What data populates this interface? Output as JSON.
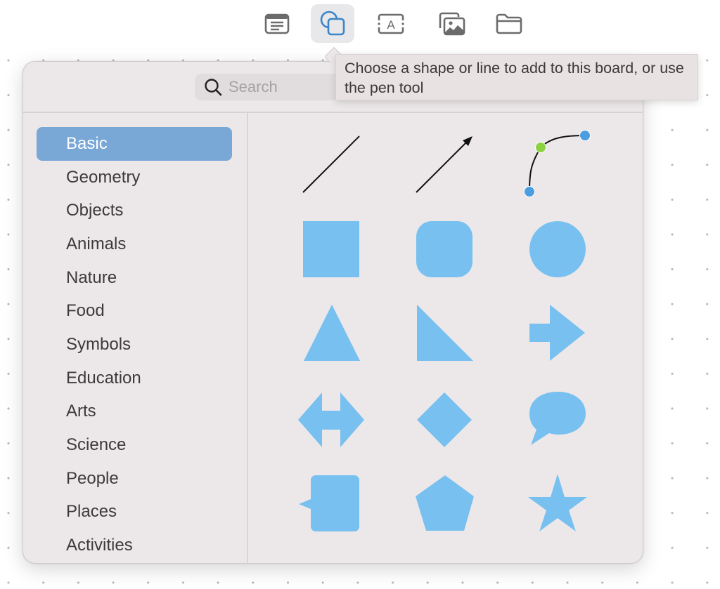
{
  "toolbar": {
    "buttons": [
      {
        "name": "text-box",
        "icon": "text-block-icon",
        "active": false
      },
      {
        "name": "shapes",
        "icon": "shapes-icon",
        "active": true
      },
      {
        "name": "text",
        "icon": "text-frame-icon",
        "active": false
      },
      {
        "name": "media",
        "icon": "photos-icon",
        "active": false
      },
      {
        "name": "files",
        "icon": "folder-icon",
        "active": false
      }
    ],
    "active_color": "#3a86c8",
    "icon_color": "#6b6b6b"
  },
  "tooltip": {
    "text": "Choose a shape or line to add to this board, or use the pen tool"
  },
  "shapes_popover": {
    "search": {
      "placeholder": "Search",
      "value": ""
    },
    "categories": [
      {
        "label": "Basic",
        "selected": true
      },
      {
        "label": "Geometry",
        "selected": false
      },
      {
        "label": "Objects",
        "selected": false
      },
      {
        "label": "Animals",
        "selected": false
      },
      {
        "label": "Nature",
        "selected": false
      },
      {
        "label": "Food",
        "selected": false
      },
      {
        "label": "Symbols",
        "selected": false
      },
      {
        "label": "Education",
        "selected": false
      },
      {
        "label": "Arts",
        "selected": false
      },
      {
        "label": "Science",
        "selected": false
      },
      {
        "label": "People",
        "selected": false
      },
      {
        "label": "Places",
        "selected": false
      },
      {
        "label": "Activities",
        "selected": false
      }
    ],
    "shapes": [
      "line",
      "arrow-line",
      "curve-pen",
      "square",
      "rounded-square",
      "circle",
      "triangle",
      "right-triangle",
      "arrow-right",
      "double-arrow",
      "diamond",
      "speech-bubble",
      "callout-square",
      "pentagon",
      "star"
    ],
    "colors": {
      "shape_fill": "#77c0f0",
      "selected_category": "#79a7d6",
      "pen_endpoint": "#4a9ee0",
      "pen_control": "#8bd143"
    }
  }
}
